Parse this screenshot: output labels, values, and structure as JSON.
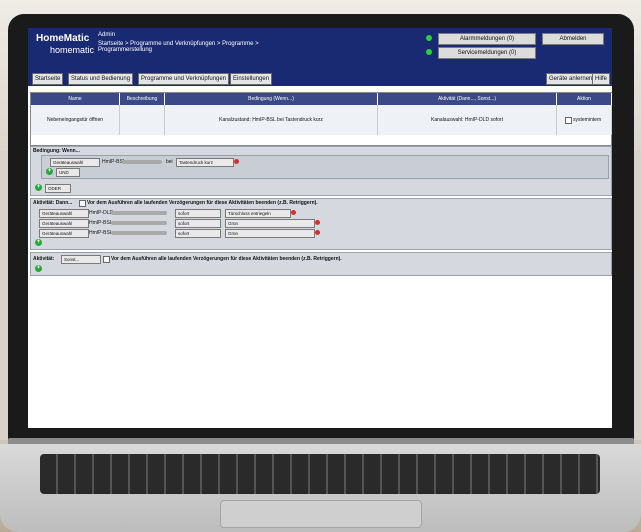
{
  "header": {
    "logo_line1": "HomeMatic",
    "logo_line2": "homematic",
    "user": "Admin",
    "breadcrumb": "Startseite > Programme und Verknüpfungen > Programme > Programmerstellung",
    "alarm_btn": "Alarmmeldungen (0)",
    "service_btn": "Servicemeldungen (0)",
    "logout_btn": "Abmelden"
  },
  "toolbar": {
    "items": [
      "Startseite",
      "Status und Bedienung",
      "Programme und Verknüpfungen",
      "Einstellungen"
    ],
    "right_items": [
      "Geräte anlernen",
      "Hilfe"
    ]
  },
  "table": {
    "headers": [
      "Name",
      "Beschreibung",
      "Bedingung (Wenn...)",
      "Aktivität (Dann..., Sonst...)",
      "Aktion"
    ],
    "row": {
      "name": "Nebeneingangstür öffnen",
      "description": "",
      "condition": "Kanalzustand: HmIP-BSL bei Tastendruck kurz",
      "activity": "Kanalauswahl: HmIP-DLD sofort",
      "action": "systemintern"
    }
  },
  "condition": {
    "title": "Bedingung: Wenn...",
    "select1": "Geräteauswahl",
    "device": "HmIP-BSL",
    "bei": "bei",
    "select2": "Tastendruck kurz",
    "und_select": "UND",
    "oder_select": "ODER"
  },
  "activity": {
    "title": "Aktivität: Dann...",
    "checkbox_label": "Vor dem Ausführen alle laufenden Verzögerungen für diese Aktivitäten beenden (z.B. Retriggern).",
    "rows": [
      {
        "select": "Geräteauswahl",
        "device": "HmIP-DLD",
        "timing": "sofort",
        "value": "Türschloss entriegeln"
      },
      {
        "select": "Geräteauswahl",
        "device": "HmIP-BSL",
        "timing": "sofort",
        "value": "Grün"
      },
      {
        "select": "Geräteauswahl",
        "device": "HmIP-BSL",
        "timing": "sofort",
        "value": "Grün"
      }
    ]
  },
  "else": {
    "title": "Aktivität:",
    "select": "Sonst...",
    "checkbox_label": "Vor dem Ausführen alle laufenden Verzögerungen für diese Aktivitäten beenden (z.B. Retriggern)."
  }
}
